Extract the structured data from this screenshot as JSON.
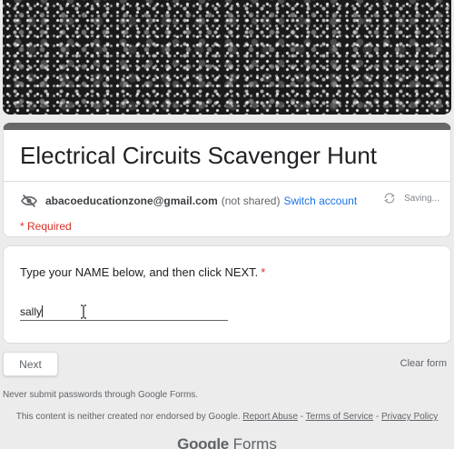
{
  "header": {
    "banner_icon": "glitter-banner-image"
  },
  "form": {
    "title": "Electrical Circuits Scavenger Hunt",
    "account": {
      "email": "abacoeducationzone@gmail.com",
      "not_shared": "(not shared)",
      "switch_label": "Switch account",
      "hidden_icon": "eye-off-icon"
    },
    "saving_status": "Saving...",
    "required_note": "* Required"
  },
  "question": {
    "label": "Type your NAME below, and then click NEXT.",
    "required_star": "*",
    "answer_value": "sally"
  },
  "actions": {
    "next_label": "Next",
    "clear_label": "Clear form"
  },
  "footer": {
    "warning": "Never submit passwords through Google Forms.",
    "disclaimer": "This content is neither created nor endorsed by Google.",
    "report_abuse": "Report Abuse",
    "sep1": " - ",
    "terms": "Terms of Service",
    "sep2": " - ",
    "privacy": "Privacy Policy",
    "logo_google": "Google",
    "logo_forms": "Forms"
  },
  "colors": {
    "accent": "#1a73e8",
    "required": "#d93025",
    "header_bar": "#676767"
  }
}
